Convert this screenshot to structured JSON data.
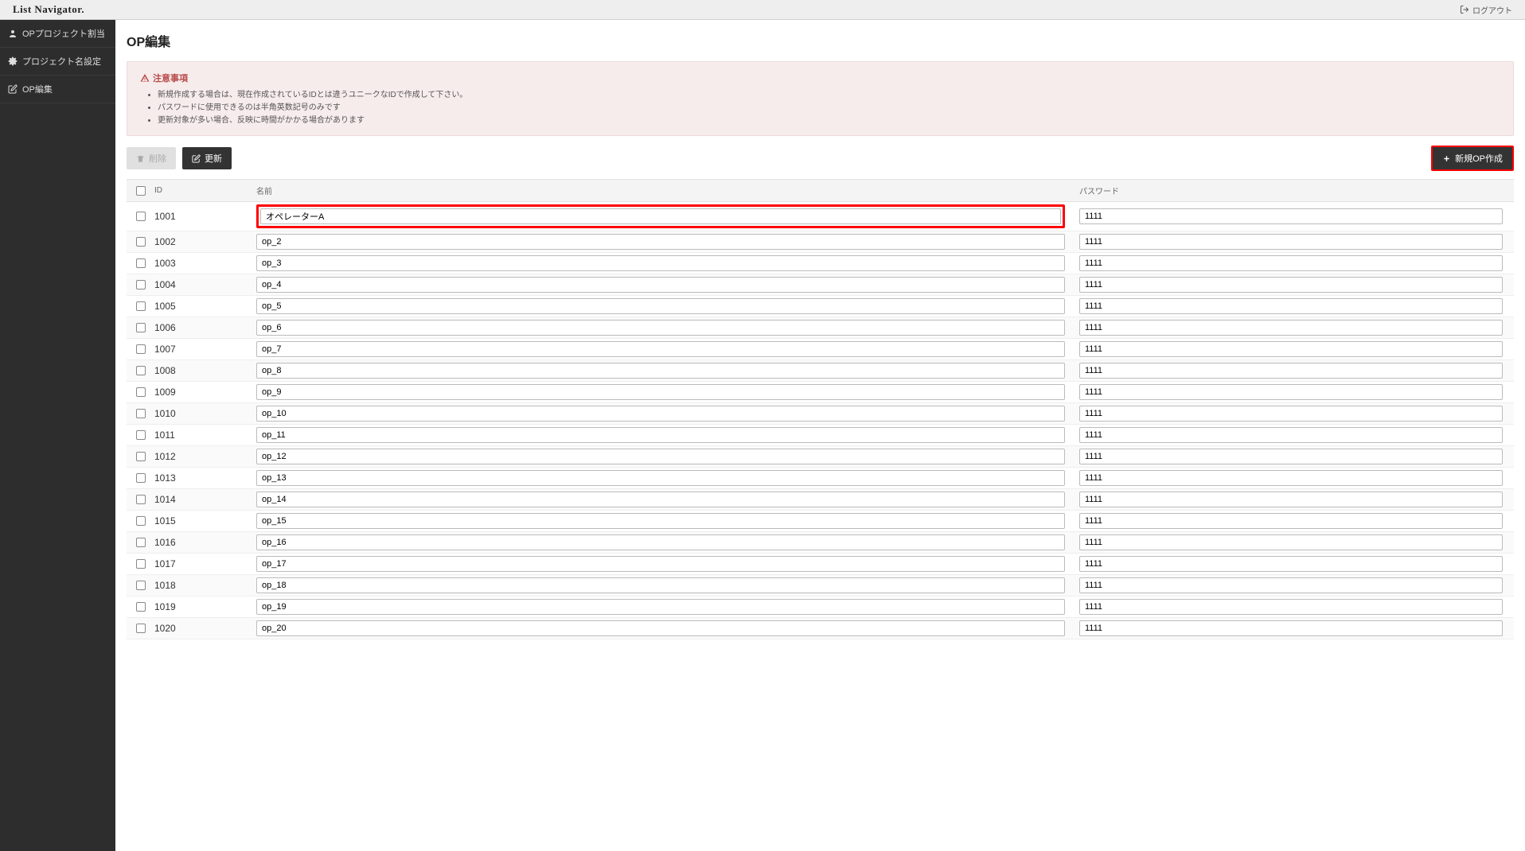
{
  "brand": "List Navigator.",
  "logout_label": "ログアウト",
  "sidebar": {
    "items": [
      {
        "label": "OPプロジェクト割当",
        "icon": "user"
      },
      {
        "label": "プロジェクト名設定",
        "icon": "gear"
      },
      {
        "label": "OP編集",
        "icon": "edit"
      }
    ]
  },
  "page_title": "OP編集",
  "alert": {
    "title": "注意事項",
    "lines": [
      "新規作成する場合は、現在作成されているIDとは違うユニークなIDで作成して下さい。",
      "パスワードに使用できるのは半角英数記号のみです",
      "更新対象が多い場合、反映に時間がかかる場合があります"
    ]
  },
  "toolbar": {
    "delete_label": "削除",
    "update_label": "更新",
    "create_label": "新規OP作成"
  },
  "table": {
    "headers": {
      "id": "ID",
      "name": "名前",
      "password": "パスワード"
    },
    "rows": [
      {
        "id": "1001",
        "name": "オペレーターA",
        "password": "1111",
        "highlight": true
      },
      {
        "id": "1002",
        "name": "op_2",
        "password": "1111"
      },
      {
        "id": "1003",
        "name": "op_3",
        "password": "1111"
      },
      {
        "id": "1004",
        "name": "op_4",
        "password": "1111"
      },
      {
        "id": "1005",
        "name": "op_5",
        "password": "1111"
      },
      {
        "id": "1006",
        "name": "op_6",
        "password": "1111"
      },
      {
        "id": "1007",
        "name": "op_7",
        "password": "1111"
      },
      {
        "id": "1008",
        "name": "op_8",
        "password": "1111"
      },
      {
        "id": "1009",
        "name": "op_9",
        "password": "1111"
      },
      {
        "id": "1010",
        "name": "op_10",
        "password": "1111"
      },
      {
        "id": "1011",
        "name": "op_11",
        "password": "1111"
      },
      {
        "id": "1012",
        "name": "op_12",
        "password": "1111"
      },
      {
        "id": "1013",
        "name": "op_13",
        "password": "1111"
      },
      {
        "id": "1014",
        "name": "op_14",
        "password": "1111"
      },
      {
        "id": "1015",
        "name": "op_15",
        "password": "1111"
      },
      {
        "id": "1016",
        "name": "op_16",
        "password": "1111"
      },
      {
        "id": "1017",
        "name": "op_17",
        "password": "1111"
      },
      {
        "id": "1018",
        "name": "op_18",
        "password": "1111"
      },
      {
        "id": "1019",
        "name": "op_19",
        "password": "1111"
      },
      {
        "id": "1020",
        "name": "op_20",
        "password": "1111"
      }
    ]
  }
}
